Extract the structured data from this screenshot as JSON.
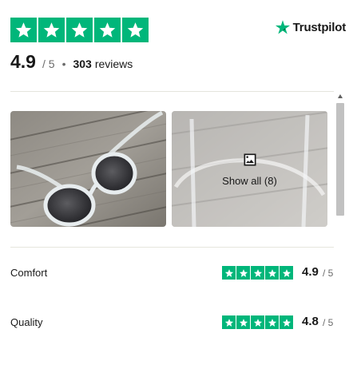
{
  "summary": {
    "score": "4.9",
    "out_of": "/ 5",
    "separator": "•",
    "review_count": "303",
    "review_label": "reviews",
    "stars": 5
  },
  "brand": {
    "name": "Trustpilot",
    "icon": "trustpilot-star-icon"
  },
  "gallery": {
    "photos": [
      {
        "name": "sunglasses-photo-1"
      },
      {
        "name": "sunglasses-photo-2"
      }
    ],
    "show_all_label": "Show all (8)",
    "show_all_icon": "image-icon"
  },
  "categories": [
    {
      "label": "Comfort",
      "score": "4.9",
      "out_of": "/ 5",
      "stars": 5
    },
    {
      "label": "Quality",
      "score": "4.8",
      "out_of": "/ 5",
      "stars": 5
    }
  ],
  "colors": {
    "star_green": "#00b67a",
    "text": "#191919",
    "muted": "#6b6b6b",
    "divider": "#e5e5dd"
  }
}
